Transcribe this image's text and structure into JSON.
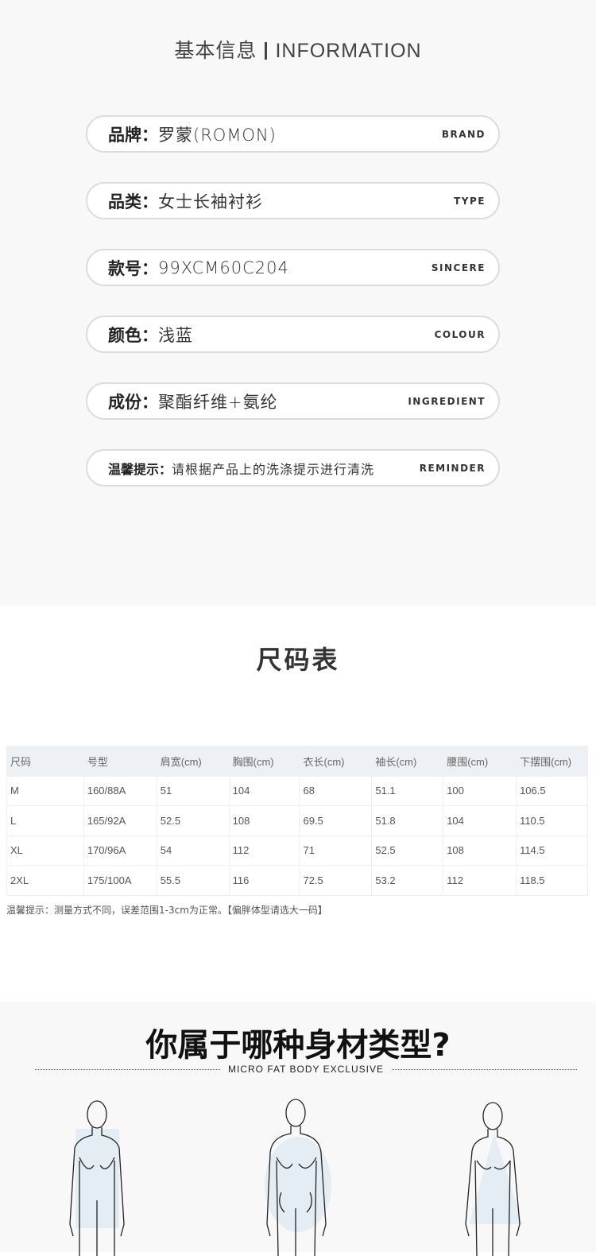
{
  "info": {
    "title_cn": "基本信息",
    "title_en": "INFORMATION",
    "rows": [
      {
        "label": "品牌：",
        "value": "罗蒙(ROMON)",
        "en": "BRAND"
      },
      {
        "label": "品类：",
        "value": "女士长袖衬衫",
        "en": "TYPE"
      },
      {
        "label": "款号：",
        "value": "99XCM60C204",
        "en": "SINCERE"
      },
      {
        "label": "颜色：",
        "value": "浅蓝",
        "en": "COLOUR"
      },
      {
        "label": "成份：",
        "value": "聚酯纤维+氨纶",
        "en": "INGREDIENT"
      },
      {
        "label": "温馨提示：",
        "value": "请根据产品上的洗涤提示进行清洗",
        "en": "REMINDER"
      }
    ]
  },
  "size": {
    "title": "尺码表",
    "headers": [
      "尺码",
      "号型",
      "肩宽(cm)",
      "胸围(cm)",
      "衣长(cm)",
      "袖长(cm)",
      "腰围(cm)",
      "下摆围(cm)"
    ],
    "rows": [
      [
        "M",
        "160/88A",
        "51",
        "104",
        "68",
        "51.1",
        "100",
        "106.5"
      ],
      [
        "L",
        "165/92A",
        "52.5",
        "108",
        "69.5",
        "51.8",
        "104",
        "110.5"
      ],
      [
        "XL",
        "170/96A",
        "54",
        "112",
        "71",
        "52.5",
        "108",
        "114.5"
      ],
      [
        "2XL",
        "175/100A",
        "55.5",
        "116",
        "72.5",
        "53.2",
        "112",
        "118.5"
      ]
    ],
    "note": "温馨提示：测量方式不同，误差范围1-3cm为正常。【偏胖体型请选大一码】"
  },
  "body": {
    "title": "你属于哪种身材类型?",
    "subtitle": "MICRO FAT BODY EXCLUSIVE"
  }
}
